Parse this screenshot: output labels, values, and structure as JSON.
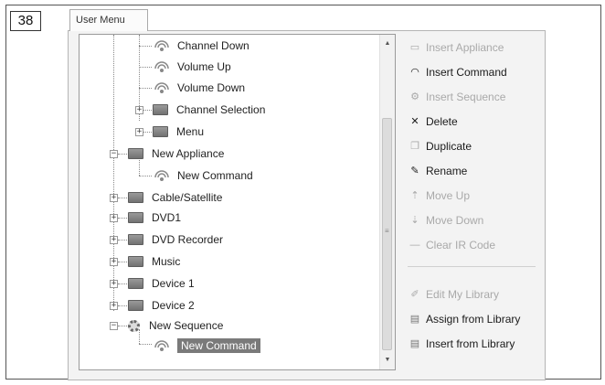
{
  "figure_number": "38",
  "tab": {
    "label": "User Menu"
  },
  "tree": {
    "nodes": [
      {
        "label": "Channel Down",
        "icon": "remote-command-icon",
        "depth": 2
      },
      {
        "label": "Volume Up",
        "icon": "remote-command-icon",
        "depth": 2
      },
      {
        "label": "Volume Down",
        "icon": "remote-command-icon",
        "depth": 2
      },
      {
        "label": "Channel Selection",
        "icon": "folder-icon",
        "depth": 2,
        "expander": "+"
      },
      {
        "label": "Menu",
        "icon": "folder-icon",
        "depth": 2,
        "expander": "+"
      },
      {
        "label": "New Appliance",
        "icon": "folder-icon",
        "depth": 1,
        "expander": "−"
      },
      {
        "label": "New Command",
        "icon": "remote-command-icon",
        "depth": 2
      },
      {
        "label": "Cable/Satellite",
        "icon": "folder-icon",
        "depth": 1,
        "expander": "+"
      },
      {
        "label": "DVD1",
        "icon": "folder-icon",
        "depth": 1,
        "expander": "+"
      },
      {
        "label": "DVD Recorder",
        "icon": "folder-icon",
        "depth": 1,
        "expander": "+"
      },
      {
        "label": "Music",
        "icon": "folder-icon",
        "depth": 1,
        "expander": "+"
      },
      {
        "label": "Device 1",
        "icon": "folder-icon",
        "depth": 1,
        "expander": "+"
      },
      {
        "label": "Device 2",
        "icon": "folder-icon",
        "depth": 1,
        "expander": "+"
      },
      {
        "label": "New Sequence",
        "icon": "gear-icon",
        "depth": 1,
        "expander": "−"
      },
      {
        "label": "New Command",
        "icon": "remote-command-icon",
        "depth": 2,
        "selected": true
      }
    ]
  },
  "commands": {
    "insert_appliance": {
      "label": "Insert Appliance",
      "enabled": false
    },
    "insert_command": {
      "label": "Insert Command",
      "enabled": true
    },
    "insert_sequence": {
      "label": "Insert Sequence",
      "enabled": false
    },
    "delete": {
      "label": "Delete",
      "enabled": true
    },
    "duplicate": {
      "label": "Duplicate",
      "enabled": true
    },
    "rename": {
      "label": "Rename",
      "enabled": true
    },
    "move_up": {
      "label": "Move Up",
      "enabled": false
    },
    "move_down": {
      "label": "Move Down",
      "enabled": false
    },
    "clear_ir_code": {
      "label": "Clear IR Code",
      "enabled": false
    },
    "edit_my_library": {
      "label": "Edit My Library",
      "enabled": false
    },
    "assign_from_library": {
      "label": "Assign from Library",
      "enabled": true
    },
    "insert_from_library": {
      "label": "Insert from Library",
      "enabled": true
    }
  },
  "colors": {
    "selection": "#7a7a7a",
    "disabled_text": "#a9a9a9",
    "enabled_text": "#1a1a1a"
  }
}
